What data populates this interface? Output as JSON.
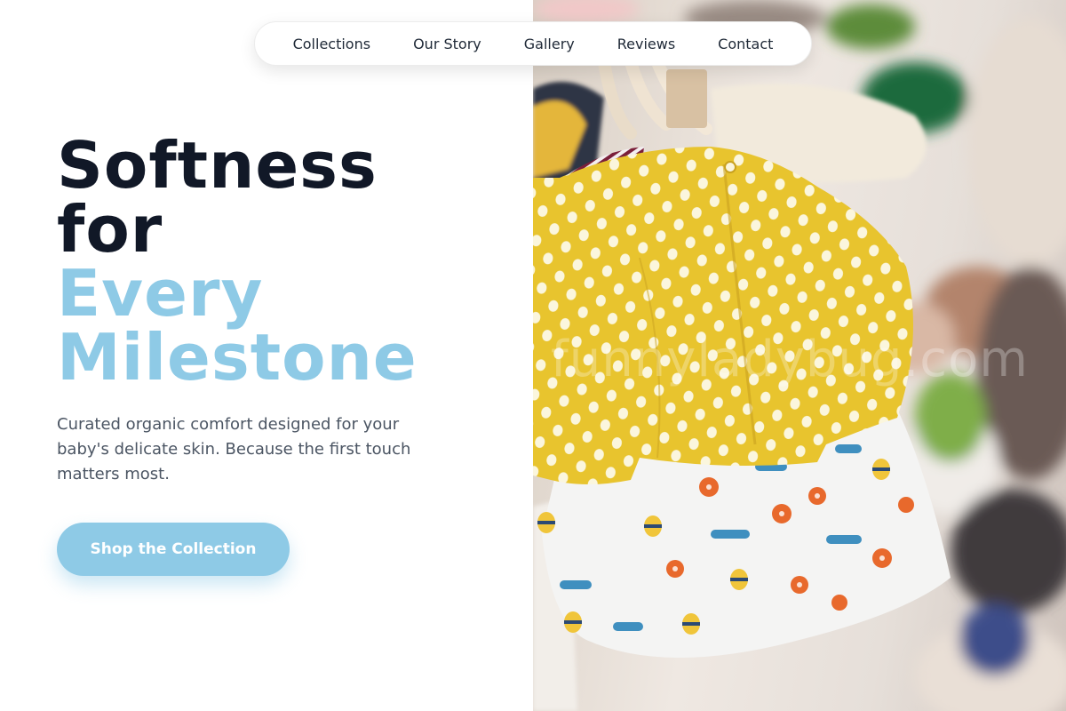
{
  "nav": {
    "items": [
      {
        "label": "Collections"
      },
      {
        "label": "Our Story"
      },
      {
        "label": "Gallery"
      },
      {
        "label": "Reviews"
      },
      {
        "label": "Contact"
      }
    ]
  },
  "hero": {
    "headline_line1": "Softness",
    "headline_line2": "for",
    "headline_line3": "Every",
    "headline_line4": "Milestone",
    "subtitle": "Curated organic comfort designed for your baby's delicate skin. Because the first touch matters most.",
    "cta_label": "Shop the Collection"
  },
  "photo": {
    "watermark": "funnyladybug.com",
    "alt": "Baby clothes on hangers: yellow polka-dot jacket over a white dress with ladybug and bee prints"
  },
  "colors": {
    "accent": "#8ecae6",
    "heading": "#111827",
    "body_text": "#4b5563"
  }
}
